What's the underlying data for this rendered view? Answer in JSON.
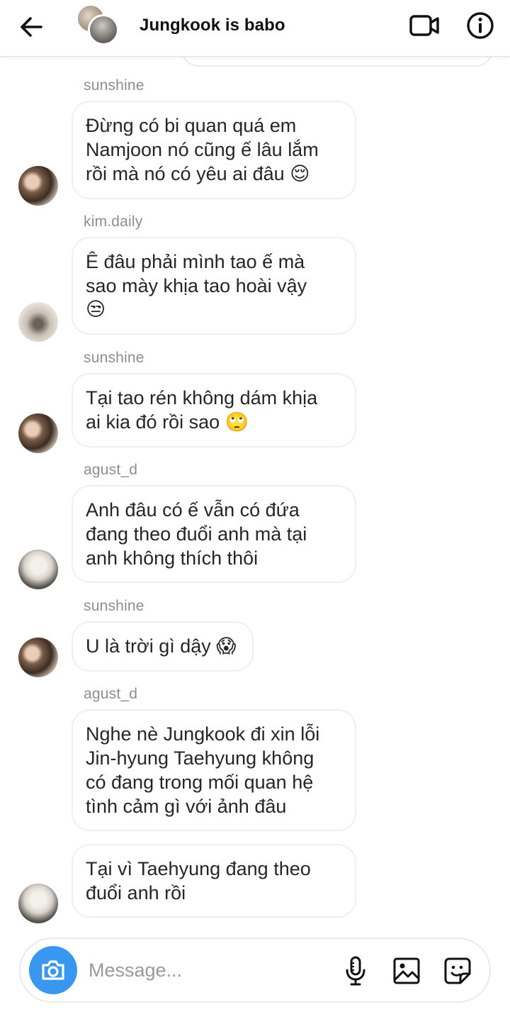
{
  "header": {
    "title": "Jungkook is babo",
    "back_icon": "arrow-left-icon",
    "video_icon": "video-camera-icon",
    "info_icon": "info-icon"
  },
  "messages": [
    {
      "sender": "sunshine",
      "lines": [
        "Đừng có bi quan quá em",
        "Namjoon nó cũng ế lâu lắm",
        "rồi mà nó có yêu ai đâu"
      ],
      "emoji": "😌",
      "emoji_icon": "relieved-face-emoji"
    },
    {
      "sender": "kim.daily",
      "lines": [
        "Ê đâu phải mình tao ế mà",
        "sao mày khịa tao hoài vậy"
      ],
      "emoji": "😒",
      "emoji_icon": "unamused-face-emoji"
    },
    {
      "sender": "sunshine",
      "lines": [
        "Tại tao rén không dám khịa",
        "ai kia đó rồi sao"
      ],
      "emoji": "🙄",
      "emoji_icon": "eye-roll-emoji"
    },
    {
      "sender": "agust_d",
      "lines": [
        "Anh đâu có ế vẫn có đứa",
        "đang theo đuổi anh mà tại",
        "anh không thích thôi"
      ]
    },
    {
      "sender": "sunshine",
      "lines": [
        "U là trời gì dậy"
      ],
      "emoji": "😱",
      "emoji_icon": "screaming-face-emoji"
    },
    {
      "sender": "agust_d",
      "lines": [
        "Nghe nè Jungkook đi xin lỗi",
        "Jin-hyung Taehyung không",
        "có đang trong mối quan hệ",
        "tình cảm gì với ảnh đâu"
      ]
    },
    {
      "lines": [
        "Tại vì Taehyung đang theo",
        "đuổi anh rồi"
      ]
    }
  ],
  "composer": {
    "placeholder": "Message...",
    "camera_icon": "camera-icon",
    "mic_icon": "microphone-icon",
    "gallery_icon": "image-gallery-icon",
    "sticker_icon": "sticker-icon"
  },
  "colors": {
    "accent": "#3a97f0",
    "bubble_border": "#efefef",
    "sender_text": "#8e8e8e"
  }
}
